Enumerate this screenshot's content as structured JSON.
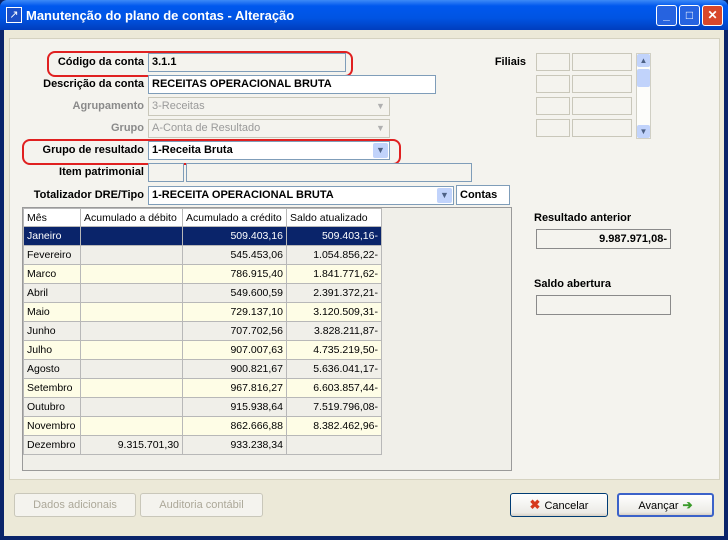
{
  "window": {
    "title": "Manutenção do plano de contas - Alteração"
  },
  "form": {
    "codigo": {
      "label": "Código da conta",
      "value": "3.1.1"
    },
    "descricao": {
      "label": "Descrição da conta",
      "value": "RECEITAS OPERACIONAL BRUTA"
    },
    "agrupamento": {
      "label": "Agrupamento",
      "value": "3-Receitas"
    },
    "grupo": {
      "label": "Grupo",
      "value": "A-Conta de Resultado"
    },
    "grupo_resultado": {
      "label": "Grupo de resultado",
      "value": "1-Receita Bruta"
    },
    "item_patrimonial": {
      "label": "Item patrimonial",
      "value": ""
    },
    "totalizador": {
      "label": "Totalizador DRE/Tipo",
      "value": "1-RECEITA OPERACIONAL BRUTA",
      "button": "Contas"
    }
  },
  "filiais": {
    "label": "Filiais"
  },
  "table": {
    "headers": [
      "Mês",
      "Acumulado a débito",
      "Acumulado a crédito",
      "Saldo atualizado"
    ],
    "rows": [
      [
        "Janeiro",
        "",
        "509.403,16",
        "509.403,16-"
      ],
      [
        "Fevereiro",
        "",
        "545.453,06",
        "1.054.856,22-"
      ],
      [
        "Marco",
        "",
        "786.915,40",
        "1.841.771,62-"
      ],
      [
        "Abril",
        "",
        "549.600,59",
        "2.391.372,21-"
      ],
      [
        "Maio",
        "",
        "729.137,10",
        "3.120.509,31-"
      ],
      [
        "Junho",
        "",
        "707.702,56",
        "3.828.211,87-"
      ],
      [
        "Julho",
        "",
        "907.007,63",
        "4.735.219,50-"
      ],
      [
        "Agosto",
        "",
        "900.821,67",
        "5.636.041,17-"
      ],
      [
        "Setembro",
        "",
        "967.816,27",
        "6.603.857,44-"
      ],
      [
        "Outubro",
        "",
        "915.938,64",
        "7.519.796,08-"
      ],
      [
        "Novembro",
        "",
        "862.666,88",
        "8.382.462,96-"
      ],
      [
        "Dezembro",
        "9.315.701,30",
        "933.238,34",
        ""
      ]
    ]
  },
  "side": {
    "resultado_anterior": {
      "label": "Resultado anterior",
      "value": "9.987.971,08-"
    },
    "saldo_abertura": {
      "label": "Saldo abertura",
      "value": ""
    }
  },
  "buttons": {
    "dados_adicionais": "Dados adicionais",
    "auditoria": "Auditoria contábil",
    "cancelar": "Cancelar",
    "avancar": "Avançar"
  },
  "colors": {
    "highlight": "#e02020",
    "selection": "#0a246a",
    "titlebar": "#0054e3"
  }
}
